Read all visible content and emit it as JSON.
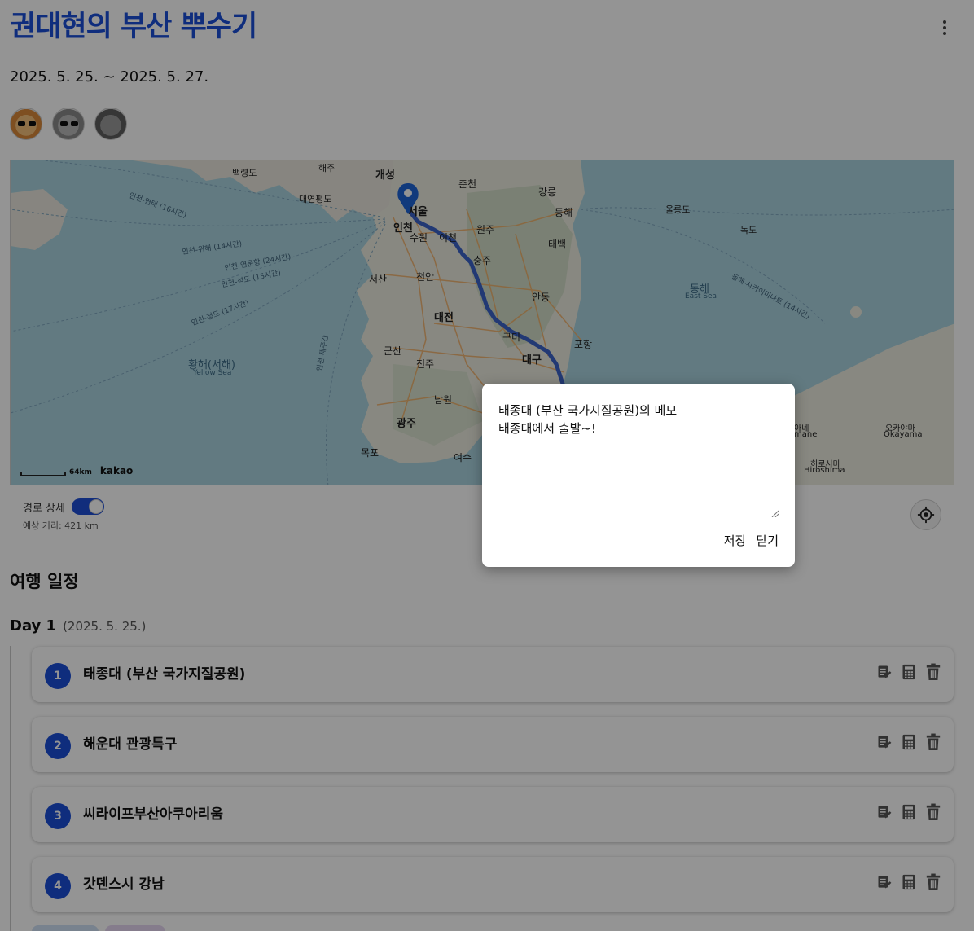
{
  "trip": {
    "title": "권대현의 부산 뿌수기",
    "dates": "2025. 5. 25. ~ 2025. 5. 27."
  },
  "map": {
    "cities": [
      "서울",
      "인천",
      "대전",
      "대구",
      "광주",
      "개성",
      "수원",
      "원주",
      "춘천",
      "충주",
      "천안",
      "서산",
      "강릉",
      "동해",
      "태백",
      "안동",
      "포항",
      "구미",
      "군산",
      "전주",
      "남원",
      "목포",
      "여수",
      "이천"
    ],
    "sea_labels": [
      "황해(서해)",
      "Yellow Sea",
      "동해",
      "East Sea"
    ],
    "islands": [
      "울릉도",
      "독도",
      "백령도",
      "대연평도",
      "해주"
    ],
    "ferry_routes": [
      "인천-위해 (14시간)",
      "인천-연운항 (24시간)",
      "인천-석도 (15시간)",
      "인천-청도 (17시간)",
      "인천-연태 (16시간)",
      "인천-제주간",
      "동해-사카이미나토 (14시간)"
    ],
    "japan_labels": [
      "오카야마",
      "Okayama",
      "히로시마",
      "Hiroshima",
      "아네",
      "mane"
    ],
    "scale": "64km",
    "attribution": "kakao"
  },
  "route_toggle": {
    "label": "경로 상세",
    "on": true,
    "distance": "예상 거리: 421 km"
  },
  "schedule": {
    "title": "여행 일정",
    "days": [
      {
        "label": "Day 1",
        "date": "(2025. 5. 25.)",
        "places": [
          {
            "num": "1",
            "name": "태종대 (부산 국가지질공원)"
          },
          {
            "num": "2",
            "name": "해운대 관광특구"
          },
          {
            "num": "3",
            "name": "씨라이프부산아쿠아리움"
          },
          {
            "num": "4",
            "name": "갓덴스시 강남"
          }
        ]
      }
    ]
  },
  "memo_modal": {
    "title": "태종대 (부산 국가지질공원)의 메모",
    "text": "태종대에서 출발~!",
    "save_label": "저장",
    "close_label": "닫기"
  },
  "icons": {
    "menu": "more-vertical-icon",
    "locate": "my-location-icon",
    "memo": "memo-edit-icon",
    "calc": "calculator-icon",
    "delete": "trash-icon"
  },
  "colors": {
    "accent": "#1b4fd8",
    "route": "#3b63c9"
  }
}
